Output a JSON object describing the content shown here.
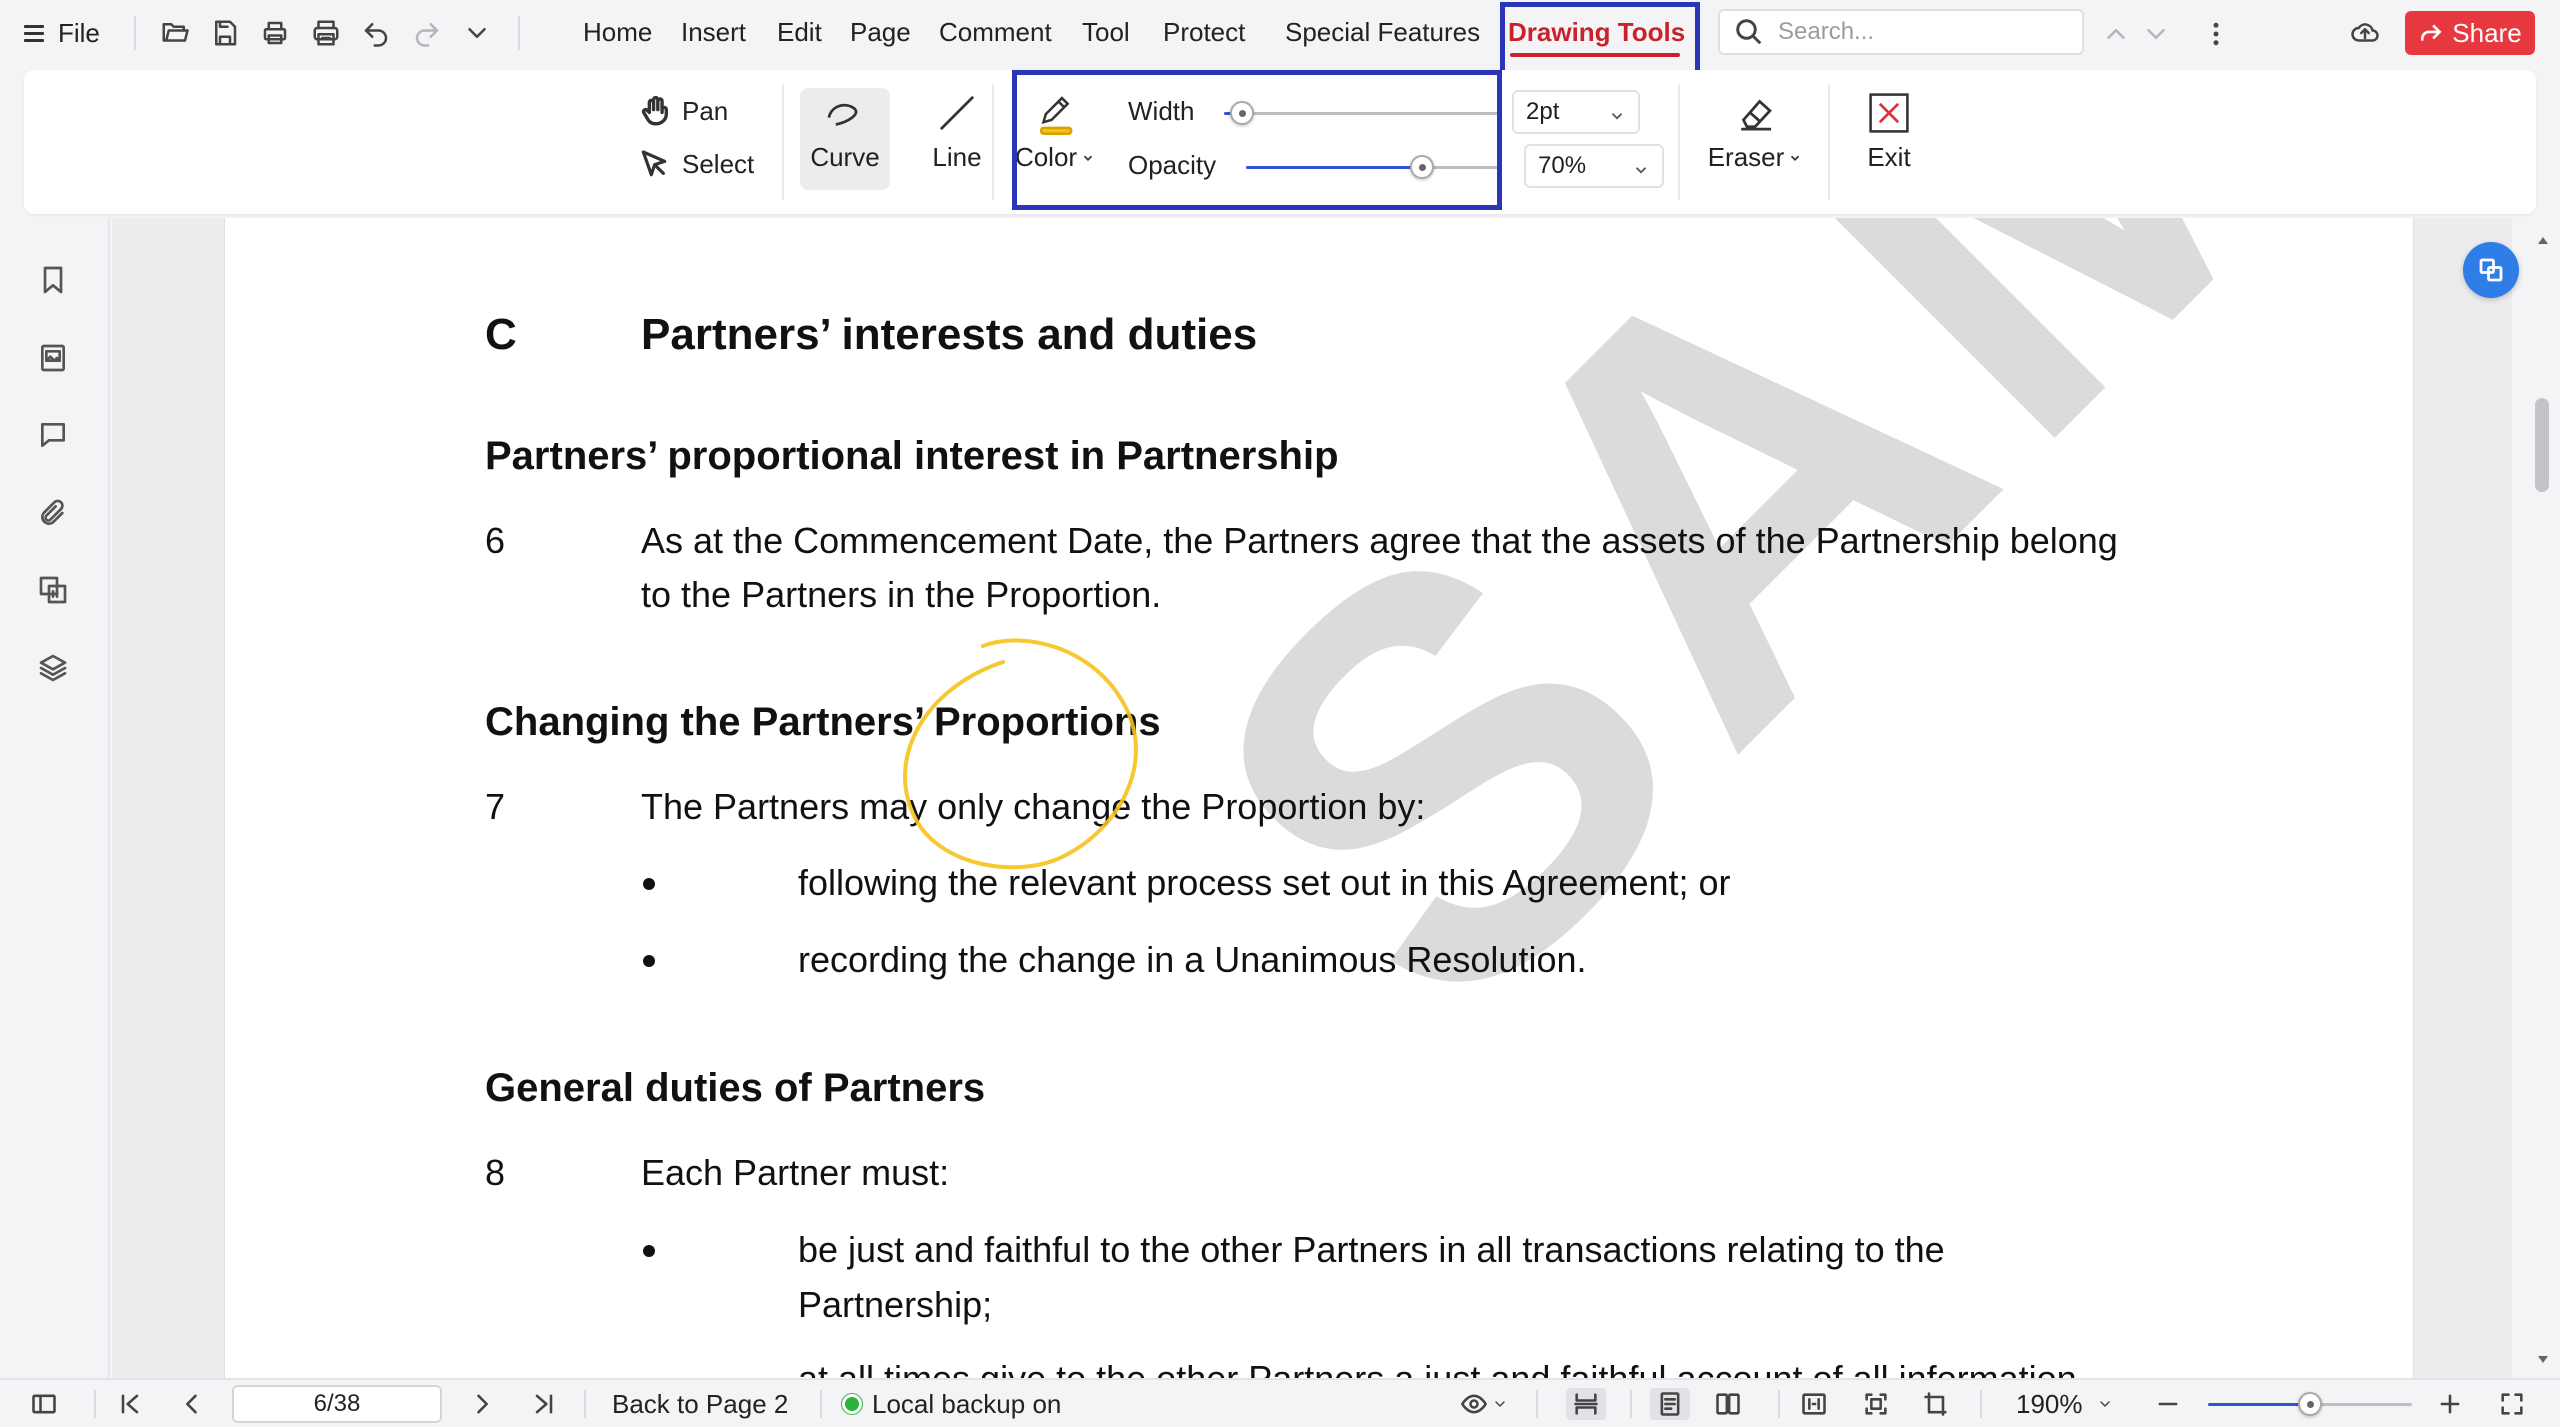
{
  "menubar": {
    "file_label": "File",
    "menu_items": [
      "Home",
      "Insert",
      "Edit",
      "Page",
      "Comment",
      "Tool",
      "Protect",
      "Special Features"
    ],
    "active_tab": "Drawing Tools",
    "search_placeholder": "Search...",
    "share_label": "Share",
    "quick_access_icons": [
      "open-folder-icon",
      "save-icon",
      "print-icon",
      "batch-print-icon",
      "undo-icon",
      "redo-icon",
      "more-dropdown-icon"
    ]
  },
  "ribbon": {
    "pan_label": "Pan",
    "select_label": "Select",
    "curve_label": "Curve",
    "line_label": "Line",
    "color_label": "Color",
    "color_value": "#f5c21b",
    "width_label": "Width",
    "width_value": "2pt",
    "opacity_label": "Opacity",
    "opacity_value": "70%",
    "eraser_label": "Eraser",
    "exit_label": "Exit",
    "width_slider_fraction": 0.0,
    "opacity_slider_fraction": 0.7
  },
  "sidebar": {
    "icons": [
      "bookmark-icon",
      "thumbnail-icon",
      "comment-icon",
      "attachment-icon",
      "form-fields-icon",
      "layers-icon"
    ]
  },
  "document": {
    "watermark": "SAMPLE",
    "section_letter": "C",
    "section_title": "Partners’ interests and duties",
    "h_interest": "Partners’ proportional interest in Partnership",
    "p6_num": "6",
    "p6_line1": "As at the Commencement Date, the Partners agree that the assets of the Partnership belong",
    "p6_line2": "to the Partners in the Proportion.",
    "h_changing": "Changing the Partners’ Proportions",
    "p7_num": "7",
    "p7_text": "The Partners may only change the Proportion by:",
    "p7_bullet1": "following the relevant process set out in this Agreement; or",
    "p7_bullet2": "recording the change in a Unanimous Resolution.",
    "h_duties": "General duties of Partners",
    "p8_num": "8",
    "p8_text": "Each Partner must:",
    "p8_bullet1_line1": "be just and faithful to the other Partners in all transactions relating to the",
    "p8_bullet1_line2": "Partnership;",
    "p8_bullet2_partial": "at all times give to the other Partners a just and faithful account of all information",
    "annotation_color": "#f5c21b"
  },
  "statusbar": {
    "page_value": "6/38",
    "back_label": "Back to Page 2",
    "backup_label": "Local backup on",
    "zoom_value": "190%",
    "zoom_slider_fraction": 0.5
  }
}
